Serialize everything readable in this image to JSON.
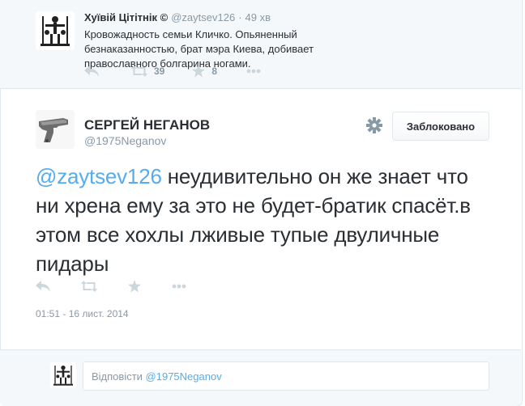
{
  "parent_tweet": {
    "name": "Хуївій Цітітнік ©",
    "screen_name": "@zaytsev126",
    "time": "49 хв",
    "text": "Кровожадность семьи Кличко. Опьяненный безнаказанностью, брат мэра Киева, добивает православного болгарина ногами.",
    "retweets": "39",
    "favorites": "8",
    "icons": [
      "reply-icon",
      "retweet-icon",
      "favorite-icon",
      "more-icon"
    ]
  },
  "main_tweet": {
    "name": "СЕРГЕЙ НЕГАНОВ",
    "screen_name": "@1975Neganov",
    "blocked_label": "Заблоковано",
    "mention": "@zaytsev126",
    "text": " неудивительно он же знает что ни хрена ему за это не будет-братик спасёт.в этом все хохлы лживые тупые двуличные пидары",
    "timestamp": "01:51 - 16 лист. 2014",
    "icons": [
      "reply-icon",
      "retweet-icon",
      "favorite-icon",
      "more-icon"
    ]
  },
  "reply_box": {
    "prefix": "Відповісти ",
    "mention": "@1975Neganov"
  },
  "colors": {
    "accent": "#55acee",
    "muted": "#8899a6",
    "icon": "#ccd6dd",
    "text": "#292f33"
  }
}
